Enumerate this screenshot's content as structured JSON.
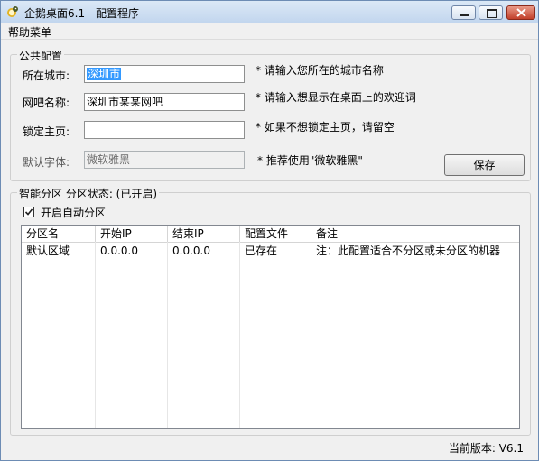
{
  "window": {
    "title": "企鹅桌面6.1 - 配置程序",
    "icon": "app-icon"
  },
  "menubar": {
    "items": [
      {
        "label": "帮助菜单"
      }
    ]
  },
  "public_config": {
    "group_label": "公共配置",
    "city": {
      "label": "所在城市:",
      "value": "深圳市",
      "tip": "* 请输入您所在的城市名称"
    },
    "netbar_name": {
      "label": "网吧名称:",
      "value": "深圳市某某网吧",
      "tip": "* 请输入想显示在桌面上的欢迎词"
    },
    "lock_homepage": {
      "label": "锁定主页:",
      "value": "",
      "tip": "* 如果不想锁定主页，请留空"
    },
    "default_font": {
      "label": "默认字体:",
      "value": "微软雅黑",
      "tip": "* 推荐使用\"微软雅黑\"",
      "disabled": true
    },
    "save_label": "保存"
  },
  "partition": {
    "group_label": "智能分区 分区状态: (已开启)",
    "auto_checkbox": {
      "label": "开启自动分区",
      "checked": true
    },
    "columns": [
      "分区名",
      "开始IP",
      "结束IP",
      "配置文件",
      "备注"
    ],
    "rows": [
      [
        "默认区域",
        "0.0.0.0",
        "0.0.0.0",
        "已存在",
        "注：此配置适合不分区或未分区的机器"
      ]
    ]
  },
  "status": {
    "version_text": "当前版本: V6.1"
  },
  "colors": {
    "title_gradient_top": "#dbe8f6",
    "selection": "#3399ff",
    "close_button": "#c2402b"
  }
}
